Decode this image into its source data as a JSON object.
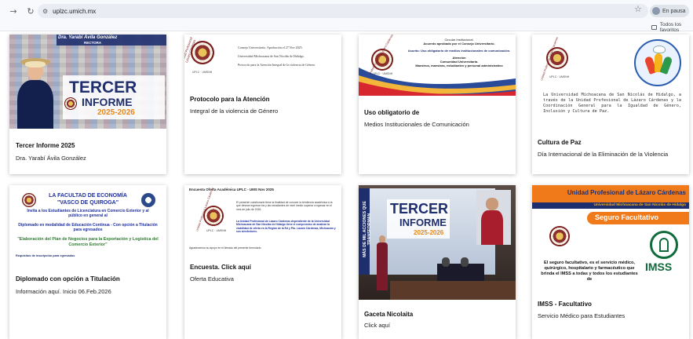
{
  "browser": {
    "url": "uplzc.umich.mx",
    "pause_label": "En pausa",
    "bookmarks_label": "Todos los favoritos"
  },
  "cards": [
    {
      "thumb": {
        "header_name": "Dra. Yarabí Ávila González",
        "header_role": "RECTORA",
        "big_title_1": "TERCER",
        "big_title_2": "INFORME",
        "years": "2025-2026"
      },
      "title": "Tercer Informe 2025",
      "text": "Dra. Yarabí Ávila González"
    },
    {
      "thumb": {
        "line1": "Consejo Universitario. Aprobación el 27 Nov 2025.",
        "line2": "Universidad Michoacana de San Nicolás de Hidalgo.",
        "line3": "Protocolo para la Atención Integral de la violencia de Género.",
        "seal_caption": "Unidad Profesional Lázaro Cárdenas",
        "seal_sub": "UPLC · UMSNH"
      },
      "title": "Protocolo para la Atención",
      "text": "Integral de la violencia de Género"
    },
    {
      "thumb": {
        "l1": "Circular Institucional.",
        "l2": "Acuerdo aprobado por el Consejo Universitario.",
        "l3": "Asunto: Uso obligatorio de medios institucionales de comunicación.",
        "l4": "Atención",
        "l5": "Comunidad Universitaria.",
        "l6": "Maestros, maestras, estudiantes y personal administrativo",
        "seal_caption": "Unidad Profesional Lázaro Cárdenas",
        "seal_sub": "UPLC · UMSNH"
      },
      "title": "Uso obligatorio de",
      "text": "Medios Institucionales de Comunicación"
    },
    {
      "thumb": {
        "paragraph": "La Universidad Michoacana de San Nicolás de Hidalgo, a través de la Unidad Profesional de Lázaro Cárdenas y la Coordinación General para la Igualdad de Género, Inclusión y Cultura de Paz.",
        "seal_caption": "Unidad Profesional Lázaro Cárdenas",
        "seal_sub": "UPLC · UMSNH"
      },
      "title": "Cultura de Paz",
      "text": "Día Internacional de la Eliminación de la Violencia"
    },
    {
      "thumb": {
        "h1": "LA FACULTAD DE ECONOMÍA",
        "h2": "\"VASCO DE QUIROGA\"",
        "p1": "Invita a los Estudiantes de Licenciatura en Comercio Exterior y al público en general al",
        "p2": "Diplomado en modalidad de Educación Continua - Con opción a Titulación para egresados",
        "p3": "\"Elaboración del Plan de Negocios para la Exportación y Logística del Comercio Exterior\"",
        "p4": "Requisitos de inscripción para egresados"
      },
      "title": "Diplomado con opción a Titulación",
      "text": "Información aquí. Inicio 06.Feb.2026"
    },
    {
      "thumb": {
        "header": "Encuesta Oferta Académica UPLC - UMS Nov 2025",
        "p1": "El presente cuestionario tiene la finalidad de conocer la tendencia académica a la que desean ingresar los y las estudiantes de nivel medio superior a egresar en el mes de julio de 2026.",
        "p2": "La Unidad Profesional de Lázaro Cárdenas dependiente de la Universidad Michoacana de San Nicolás de Hidalgo tiene el compromiso de analizar la viabilidad de oferta en la Región de la Ed y Pto. Lázaro Cárdenas, Michoacán y sus alrededores.",
        "p3": "Agradecemos su apoyo en el llenado del presente formulario.",
        "seal_caption": "Unidad Profesional Lázaro Cárdenas",
        "seal_sub": "UPLC · UMSNH"
      },
      "title": "Encuesta. Click aquí",
      "text": "Oferta Educativa"
    },
    {
      "thumb": {
        "vertical": "MÁS DE MIL ACCIONES QUE TRANSFORMAN",
        "big_title_1": "TERCER",
        "big_title_2": "INFORME",
        "years": "2025-2026"
      },
      "title": "Gaceta Nicolaita",
      "text": "Click aquí"
    },
    {
      "thumb": {
        "h1": "Unidad Profesional de Lázaro Cárdenas",
        "h2": "Universidad Michoacana de San Nicolás de Hidalgo",
        "ribbon": "Seguro Facultativo",
        "p1": "El seguro facultativo, es el servicio médico, quirúrgico, hospitalario y farmacéutico que brinda el IMSS a todas y todos los estudiantes de",
        "imss": "IMSS"
      },
      "title": "IMSS - Facultativo",
      "text": "Servicio Médico para Estudiantes"
    }
  ],
  "colors": {
    "navy": "#1f2f6e",
    "accent_orange": "#f07a1a",
    "imss_green": "#0f6b3b",
    "card_bg": "#ffffff"
  }
}
